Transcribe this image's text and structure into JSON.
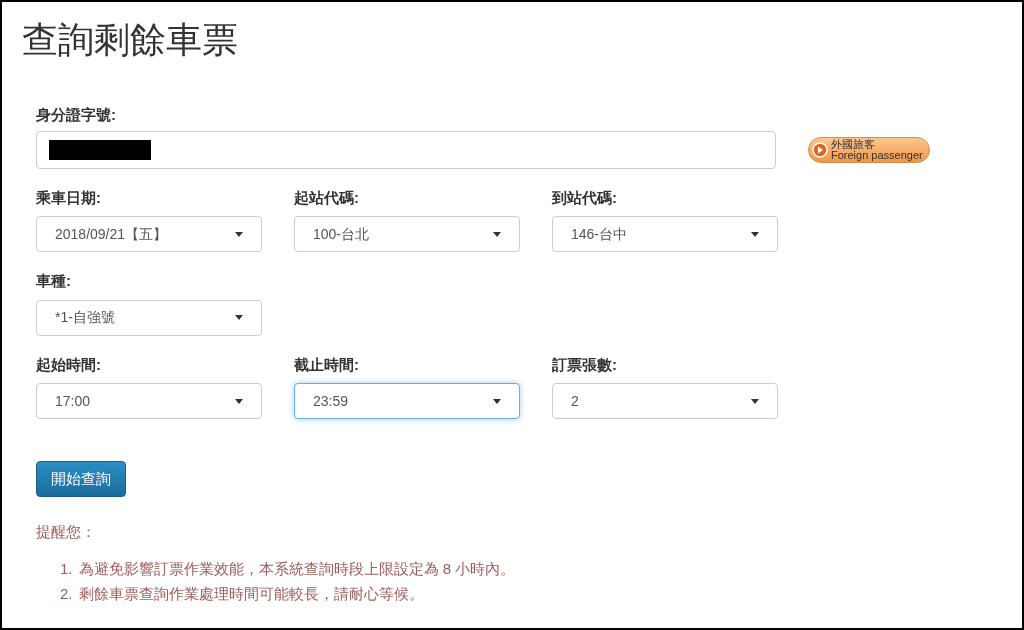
{
  "title": "查詢剩餘車票",
  "id_field": {
    "label": "身分證字號:",
    "redacted": true
  },
  "foreign_button": {
    "line1": "外國旅客",
    "line2": "Foreign passenger"
  },
  "select_rows": [
    [
      {
        "label": "乘車日期:",
        "value": "2018/09/21【五】",
        "focused": false
      },
      {
        "label": "起站代碼:",
        "value": "100-台北",
        "focused": false
      },
      {
        "label": "到站代碼:",
        "value": "146-台中",
        "focused": false
      }
    ],
    [
      {
        "label": "車種:",
        "value": "*1-自強號",
        "focused": false
      }
    ],
    [
      {
        "label": "起始時間:",
        "value": "17:00",
        "focused": false
      },
      {
        "label": "截止時間:",
        "value": "23:59",
        "focused": true
      },
      {
        "label": "訂票張數:",
        "value": "2",
        "focused": false
      }
    ]
  ],
  "submit_button": "開始查詢",
  "reminder": {
    "heading": "提醒您：",
    "items": [
      {
        "number": "1.",
        "text": "為避免影響訂票作業效能，本系統查詢時段上限設定為 8 小時內。"
      },
      {
        "number": "2.",
        "text": "剩餘車票查詢作業處理時間可能較長，請耐心等候。"
      }
    ]
  }
}
